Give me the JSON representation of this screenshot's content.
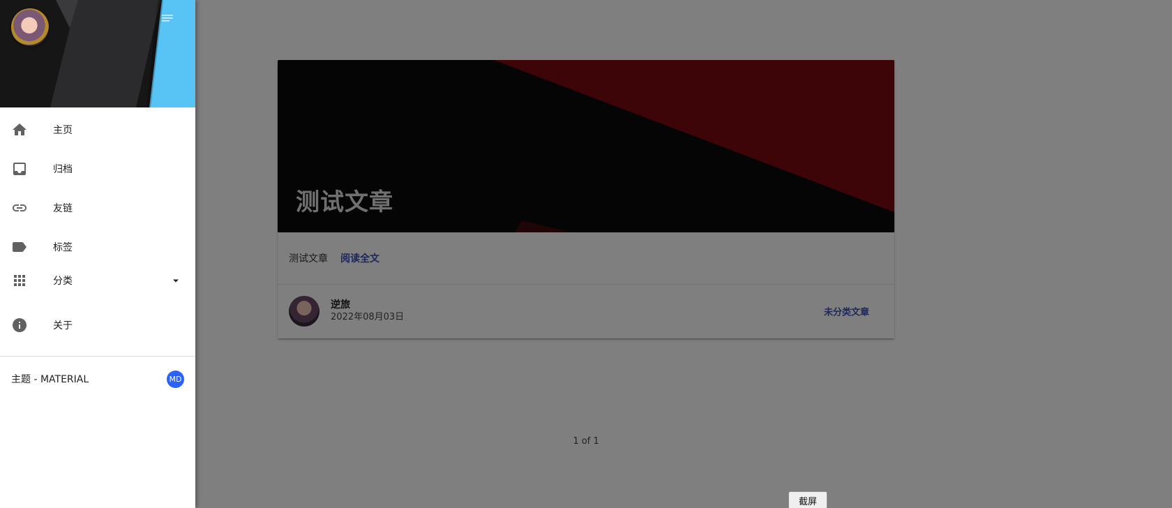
{
  "drawer": {
    "menu": [
      {
        "label": "主页",
        "icon": "home-icon"
      },
      {
        "label": "归档",
        "icon": "inbox-icon"
      },
      {
        "label": "友链",
        "icon": "link-icon"
      },
      {
        "label": "标签",
        "icon": "label-icon"
      },
      {
        "label": "分类",
        "icon": "apps-icon",
        "expandable": true
      },
      {
        "label": "关于",
        "icon": "info-icon"
      }
    ],
    "theme": {
      "label": "主题 - MATERIAL",
      "badge": "MD"
    }
  },
  "post": {
    "title": "测试文章",
    "excerpt": "测试文章",
    "read_more": "阅读全文",
    "author": "逆旅",
    "date": "2022年08月03日",
    "category": "未分类文章"
  },
  "pagination": {
    "text": "1 of 1"
  },
  "screenshot_button": {
    "label": "截屏"
  },
  "colors": {
    "accent": "#3f51b5",
    "header_blue": "#58c3f5",
    "theme_badge": "#2962ff",
    "banner_red": "#7a0a0e"
  }
}
